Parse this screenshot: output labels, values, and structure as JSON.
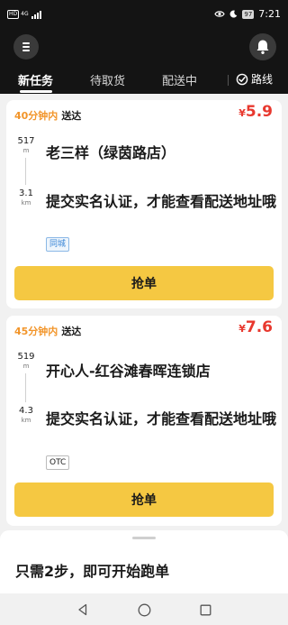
{
  "status_bar": {
    "hd_label": "HD",
    "network_label": "4G",
    "battery": "97",
    "time": "7:21"
  },
  "header": {
    "menu_icon": "menu-icon",
    "bell_icon": "bell-icon"
  },
  "tabs": [
    {
      "label": "新任务",
      "active": true
    },
    {
      "label": "待取货",
      "active": false
    },
    {
      "label": "配送中",
      "active": false
    }
  ],
  "route_tab": {
    "label": "路线",
    "icon": "route-icon"
  },
  "orders": [
    {
      "eta_accent": "40分钟内",
      "eta_rest": "送达",
      "currency": "¥",
      "price": "5.9",
      "pickup_distance": "517",
      "pickup_unit": "m",
      "delivery_distance": "3.1",
      "delivery_unit": "km",
      "shop_name": "老三样（绿茵路店）",
      "address_notice": "提交实名认证，才能查看配送地址哦",
      "tag": "同城",
      "grab_label": "抢单"
    },
    {
      "eta_accent": "45分钟内",
      "eta_rest": "送达",
      "currency": "¥",
      "price": "7.6",
      "pickup_distance": "519",
      "pickup_unit": "m",
      "delivery_distance": "4.3",
      "delivery_unit": "km",
      "shop_name": "开心人-红谷滩春晖连锁店",
      "address_notice": "提交实名认证，才能查看配送地址哦",
      "tag": "OTC",
      "grab_label": "抢单"
    }
  ],
  "bottom_sheet": {
    "title": "只需2步，即可开始跑单"
  },
  "colors": {
    "header_bg": "#141414",
    "accent_orange": "#f2952a",
    "price_red": "#e8382e",
    "button_yellow": "#f5c842",
    "tag_blue": "#3a86d6"
  }
}
